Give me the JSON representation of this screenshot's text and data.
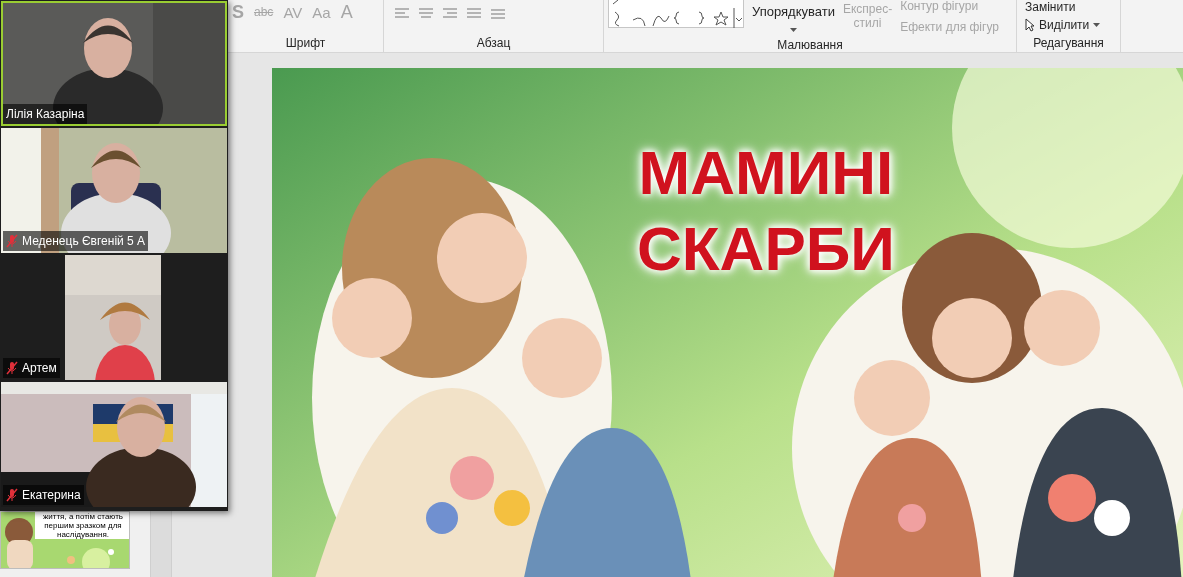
{
  "ribbon": {
    "font_buttons": [
      "S",
      "abc",
      "AV",
      "Aa",
      "A"
    ],
    "groups": [
      {
        "label": "Шрифт"
      },
      {
        "label": "Абзац"
      },
      {
        "label": "Малювання"
      },
      {
        "label": "Редагування"
      }
    ],
    "arrange": {
      "label": "Упорядкувати",
      "disabled": false
    },
    "quick_styles": {
      "lines": [
        "Експрес-",
        "стилі"
      ],
      "disabled": true
    },
    "shape_outline": {
      "label": "Контур фігури",
      "disabled": true
    },
    "shape_effects": {
      "label": "Ефекти для фігур",
      "disabled": true
    },
    "replace": {
      "label": "Замінити",
      "disabled": false
    },
    "select": {
      "label": "Виділити",
      "disabled": false
    }
  },
  "participants": [
    {
      "name": "Лілія Казаріна",
      "muted": false,
      "active_speaker": true,
      "kind": "wide"
    },
    {
      "name": "Меденець Євгеній 5 А",
      "muted": true,
      "active_speaker": false,
      "kind": "wide"
    },
    {
      "name": "Артем",
      "muted": true,
      "active_speaker": false,
      "kind": "portrait"
    },
    {
      "name": "Екатерина",
      "muted": true,
      "active_speaker": false,
      "kind": "wide"
    }
  ],
  "thumbnail": {
    "text": "життя, а потім стають першим зразком для наслідування."
  },
  "slide": {
    "title_lines": [
      "МАМИНІ",
      "СКАРБИ"
    ]
  }
}
